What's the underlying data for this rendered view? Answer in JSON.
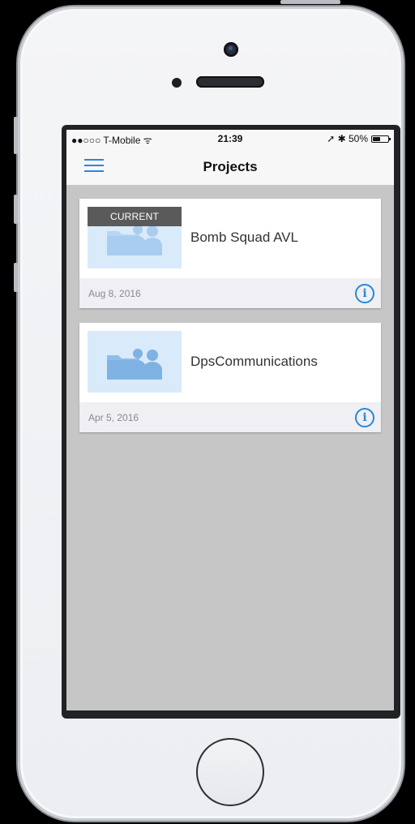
{
  "status_bar": {
    "carrier": "●●○○○ T-Mobile ᯤ",
    "time": "21:39",
    "right": "➚ ✱ 50%",
    "battery_level": 0.5
  },
  "nav": {
    "title": "Projects",
    "menu_icon": "hamburger-menu-icon"
  },
  "projects": [
    {
      "title": "Bomb Squad AVL",
      "date": "Aug 8, 2016",
      "badge": "CURRENT",
      "info_icon": "info-icon"
    },
    {
      "title": "DpsCommunications",
      "date": "Apr 5, 2016",
      "badge": "",
      "info_icon": "info-icon"
    }
  ],
  "colors": {
    "accent": "#2a87d8",
    "background": "#c6c6c6",
    "thumb": "#d9ebfa",
    "badge": "#5a5a5a"
  }
}
